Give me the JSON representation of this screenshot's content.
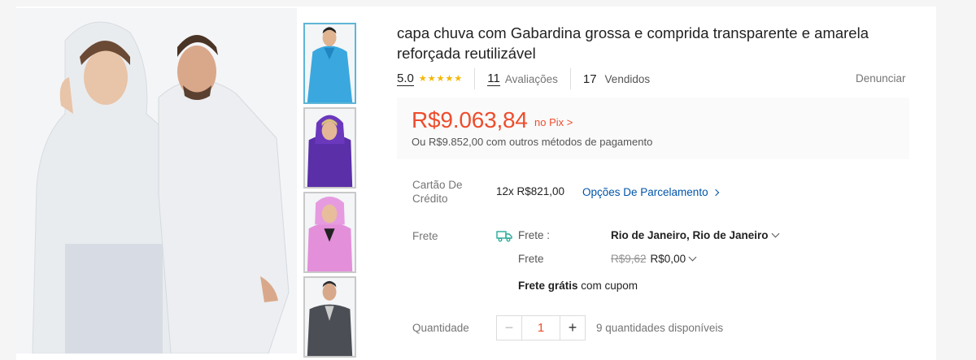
{
  "product": {
    "title": "capa chuva com Gabardina grossa e comprida transparente e amarela reforçada reutilizável",
    "rating": "5.0",
    "stars": 5,
    "reviews_count": "11",
    "reviews_label": "Avaliações",
    "sold_count": "17",
    "sold_label": "Vendidos",
    "report_label": "Denunciar"
  },
  "price": {
    "current": "R$9.063,84",
    "pix_label": "no Pix >",
    "alternative": "Ou R$9.852,00 com outros métodos de pagamento"
  },
  "payment": {
    "label": "Cartão De Crédito",
    "installments": "12x R$821,00",
    "options_label": "Opções De Parcelamento"
  },
  "shipping": {
    "label": "Frete",
    "sub_label": "Frete :",
    "destination": "Rio de Janeiro, Rio de Janeiro",
    "cost_label": "Frete",
    "old_cost": "R$9,62",
    "new_cost": "R$0,00",
    "free_bold": "Frete grátis",
    "free_rest": " com cupom"
  },
  "quantity": {
    "label": "Quantidade",
    "value": "1",
    "minus": "−",
    "plus": "+",
    "available": "9 quantidades disponíveis"
  },
  "colors": {
    "accent": "#ee4d2d",
    "link": "#0055aa",
    "star": "#f7b500",
    "thumb_active_border": "#5fb5d6"
  }
}
